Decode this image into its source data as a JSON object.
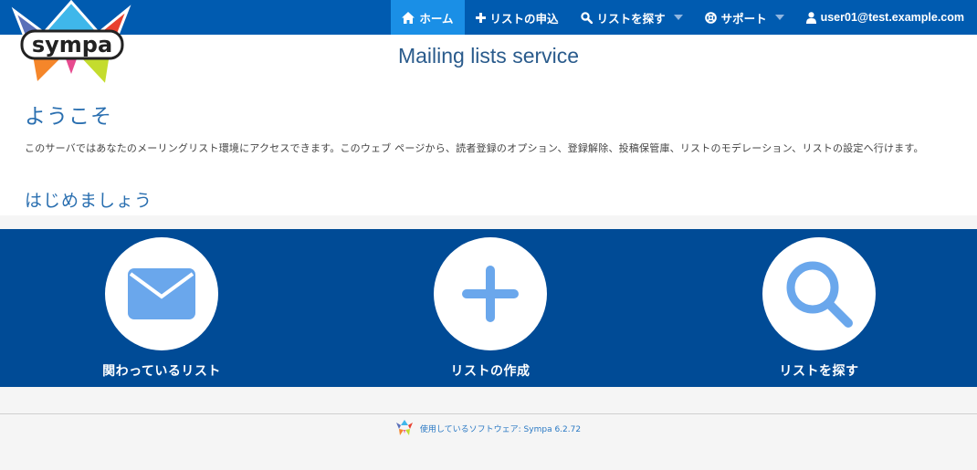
{
  "nav": {
    "home": "ホーム",
    "request_list": "リストの申込",
    "search_lists": "リストを探す",
    "support": "サポート",
    "user": "user01@test.example.com"
  },
  "logo": {
    "text": "sympa"
  },
  "header": {
    "title": "Mailing lists service"
  },
  "main": {
    "welcome_heading": "ようこそ",
    "intro": "このサーバではあなたのメーリングリスト環境にアクセスできます。このウェブ ページから、読者登録のオプション、登録解除、投稿保管庫、リストのモデレーション、リストの設定へ行けます。",
    "getting_started": "はじめましょう"
  },
  "actions": [
    {
      "label": "関わっているリスト",
      "icon": "envelope-icon"
    },
    {
      "label": "リストの作成",
      "icon": "plus-icon"
    },
    {
      "label": "リストを探す",
      "icon": "magnifier-icon"
    }
  ],
  "footer": {
    "text": "使用しているソフトウェア: Sympa 6.2.72"
  },
  "colors": {
    "navbar": "#005bb0",
    "nav_active": "#1a8fe6",
    "actions_band": "#004b96",
    "icon_blue": "#6aa7ec"
  }
}
